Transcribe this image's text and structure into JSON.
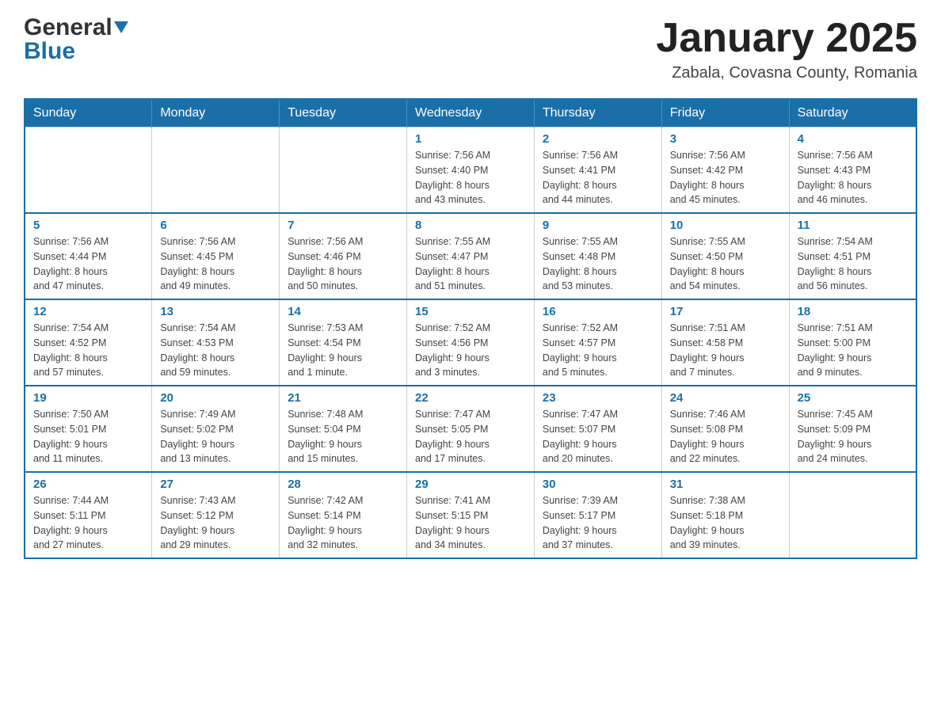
{
  "logo": {
    "general": "General",
    "triangle": "▲",
    "blue": "Blue"
  },
  "title": "January 2025",
  "subtitle": "Zabala, Covasna County, Romania",
  "days_of_week": [
    "Sunday",
    "Monday",
    "Tuesday",
    "Wednesday",
    "Thursday",
    "Friday",
    "Saturday"
  ],
  "weeks": [
    [
      {
        "day": "",
        "info": ""
      },
      {
        "day": "",
        "info": ""
      },
      {
        "day": "",
        "info": ""
      },
      {
        "day": "1",
        "info": "Sunrise: 7:56 AM\nSunset: 4:40 PM\nDaylight: 8 hours\nand 43 minutes."
      },
      {
        "day": "2",
        "info": "Sunrise: 7:56 AM\nSunset: 4:41 PM\nDaylight: 8 hours\nand 44 minutes."
      },
      {
        "day": "3",
        "info": "Sunrise: 7:56 AM\nSunset: 4:42 PM\nDaylight: 8 hours\nand 45 minutes."
      },
      {
        "day": "4",
        "info": "Sunrise: 7:56 AM\nSunset: 4:43 PM\nDaylight: 8 hours\nand 46 minutes."
      }
    ],
    [
      {
        "day": "5",
        "info": "Sunrise: 7:56 AM\nSunset: 4:44 PM\nDaylight: 8 hours\nand 47 minutes."
      },
      {
        "day": "6",
        "info": "Sunrise: 7:56 AM\nSunset: 4:45 PM\nDaylight: 8 hours\nand 49 minutes."
      },
      {
        "day": "7",
        "info": "Sunrise: 7:56 AM\nSunset: 4:46 PM\nDaylight: 8 hours\nand 50 minutes."
      },
      {
        "day": "8",
        "info": "Sunrise: 7:55 AM\nSunset: 4:47 PM\nDaylight: 8 hours\nand 51 minutes."
      },
      {
        "day": "9",
        "info": "Sunrise: 7:55 AM\nSunset: 4:48 PM\nDaylight: 8 hours\nand 53 minutes."
      },
      {
        "day": "10",
        "info": "Sunrise: 7:55 AM\nSunset: 4:50 PM\nDaylight: 8 hours\nand 54 minutes."
      },
      {
        "day": "11",
        "info": "Sunrise: 7:54 AM\nSunset: 4:51 PM\nDaylight: 8 hours\nand 56 minutes."
      }
    ],
    [
      {
        "day": "12",
        "info": "Sunrise: 7:54 AM\nSunset: 4:52 PM\nDaylight: 8 hours\nand 57 minutes."
      },
      {
        "day": "13",
        "info": "Sunrise: 7:54 AM\nSunset: 4:53 PM\nDaylight: 8 hours\nand 59 minutes."
      },
      {
        "day": "14",
        "info": "Sunrise: 7:53 AM\nSunset: 4:54 PM\nDaylight: 9 hours\nand 1 minute."
      },
      {
        "day": "15",
        "info": "Sunrise: 7:52 AM\nSunset: 4:56 PM\nDaylight: 9 hours\nand 3 minutes."
      },
      {
        "day": "16",
        "info": "Sunrise: 7:52 AM\nSunset: 4:57 PM\nDaylight: 9 hours\nand 5 minutes."
      },
      {
        "day": "17",
        "info": "Sunrise: 7:51 AM\nSunset: 4:58 PM\nDaylight: 9 hours\nand 7 minutes."
      },
      {
        "day": "18",
        "info": "Sunrise: 7:51 AM\nSunset: 5:00 PM\nDaylight: 9 hours\nand 9 minutes."
      }
    ],
    [
      {
        "day": "19",
        "info": "Sunrise: 7:50 AM\nSunset: 5:01 PM\nDaylight: 9 hours\nand 11 minutes."
      },
      {
        "day": "20",
        "info": "Sunrise: 7:49 AM\nSunset: 5:02 PM\nDaylight: 9 hours\nand 13 minutes."
      },
      {
        "day": "21",
        "info": "Sunrise: 7:48 AM\nSunset: 5:04 PM\nDaylight: 9 hours\nand 15 minutes."
      },
      {
        "day": "22",
        "info": "Sunrise: 7:47 AM\nSunset: 5:05 PM\nDaylight: 9 hours\nand 17 minutes."
      },
      {
        "day": "23",
        "info": "Sunrise: 7:47 AM\nSunset: 5:07 PM\nDaylight: 9 hours\nand 20 minutes."
      },
      {
        "day": "24",
        "info": "Sunrise: 7:46 AM\nSunset: 5:08 PM\nDaylight: 9 hours\nand 22 minutes."
      },
      {
        "day": "25",
        "info": "Sunrise: 7:45 AM\nSunset: 5:09 PM\nDaylight: 9 hours\nand 24 minutes."
      }
    ],
    [
      {
        "day": "26",
        "info": "Sunrise: 7:44 AM\nSunset: 5:11 PM\nDaylight: 9 hours\nand 27 minutes."
      },
      {
        "day": "27",
        "info": "Sunrise: 7:43 AM\nSunset: 5:12 PM\nDaylight: 9 hours\nand 29 minutes."
      },
      {
        "day": "28",
        "info": "Sunrise: 7:42 AM\nSunset: 5:14 PM\nDaylight: 9 hours\nand 32 minutes."
      },
      {
        "day": "29",
        "info": "Sunrise: 7:41 AM\nSunset: 5:15 PM\nDaylight: 9 hours\nand 34 minutes."
      },
      {
        "day": "30",
        "info": "Sunrise: 7:39 AM\nSunset: 5:17 PM\nDaylight: 9 hours\nand 37 minutes."
      },
      {
        "day": "31",
        "info": "Sunrise: 7:38 AM\nSunset: 5:18 PM\nDaylight: 9 hours\nand 39 minutes."
      },
      {
        "day": "",
        "info": ""
      }
    ]
  ]
}
